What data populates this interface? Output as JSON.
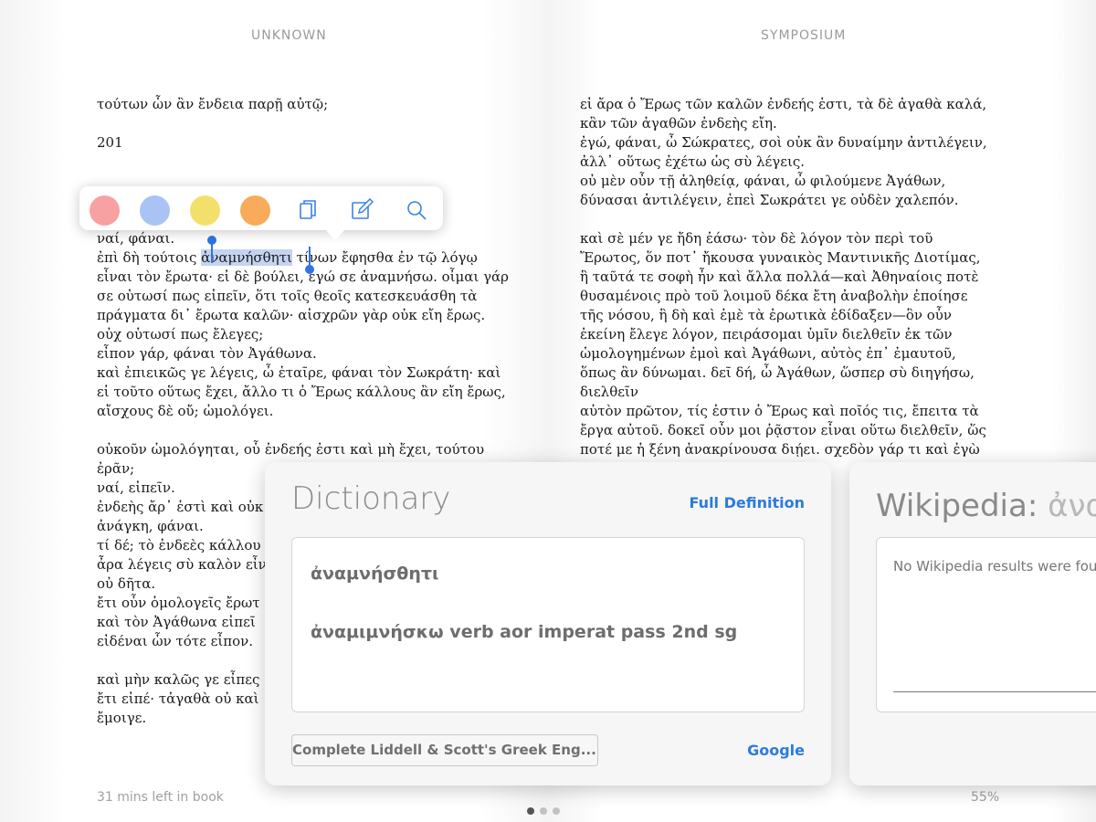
{
  "header": {
    "left_title": "UNKNOWN",
    "right_title": "SYMPOSIUM"
  },
  "left_page": {
    "top_lines": [
      "τούτων ὧν ἂν ἔνδεια παρῇ αὐτῷ;",
      "201"
    ],
    "line_before_selection": "ναί, φάναι.",
    "selection_line": {
      "before": "ἐπὶ δὴ τούτοις ",
      "selected": "ἀναμνήσθητι",
      "after": " τίνων ἔφησθα ἐν τῷ λόγῳ"
    },
    "paragraph1_rest": [
      "εἶναι τὸν ἔρωτα· εἰ δὲ βούλει, ἐγώ σε ἀναμνήσω. οἶμαι γάρ",
      "σε οὑτωσί πως εἰπεῖν, ὅτι τοῖς θεοῖς κατεσκευάσθη τὰ",
      "πράγματα δι᾽ ἔρωτα καλῶν· αἰσχρῶν γὰρ οὐκ εἴη ἔρως.",
      "οὐχ οὑτωσί πως ἔλεγες;",
      "εἶπον γάρ, φάναι τὸν Ἀγάθωνα.",
      "καὶ ἐπιεικῶς γε λέγεις, ὦ ἑταῖρε, φάναι τὸν Σωκράτη· καὶ",
      "εἰ τοῦτο οὕτως ἔχει, ἄλλο τι ὁ Ἔρως κάλλους ἂν εἴη ἔρως,",
      "αἴσχους δὲ οὔ; ὡμολόγει."
    ],
    "paragraph2": [
      "οὐκοῦν ὡμολόγηται, οὗ ἐνδεής ἐστι καὶ μὴ ἔχει, τούτου",
      "ἐρᾶν;",
      "ναί, εἰπεῖν.",
      "ἐνδεὴς ἄρ᾽ ἐστὶ καὶ οὐκ",
      "ἀνάγκη, φάναι.",
      "τί δέ; τὸ ἐνδεὲς κάλλου",
      "ἆρα λέγεις σὺ καλὸν εἶν",
      "οὐ δῆτα.",
      "ἔτι οὖν ὁμολογεῖς ἔρωτ",
      "καὶ τὸν Ἀγάθωνα εἰπεῖ",
      "εἰδέναι ὧν τότε εἶπον."
    ],
    "paragraph3": [
      "καὶ μὴν καλῶς γε εἶπες",
      "ἔτι εἰπέ· τἀγαθὰ οὐ καὶ",
      "ἔμοιγε."
    ],
    "footer": "31 mins left in book"
  },
  "right_page": {
    "paragraph1": [
      "εἰ ἄρα ὁ Ἔρως τῶν καλῶν ἐνδεής ἐστι, τὰ δὲ ἀγαθὰ καλά,",
      "κἂν τῶν ἀγαθῶν ἐνδεὴς εἴη.",
      "ἐγώ, φάναι, ὦ Σώκρατες, σοὶ οὐκ ἂν δυναίμην ἀντιλέγειν,",
      "ἀλλ᾽ οὕτως ἐχέτω ὡς σὺ λέγεις.",
      "οὐ μὲν οὖν τῇ ἀληθείᾳ, φάναι, ὦ φιλούμενε Ἀγάθων,",
      "δύνασαι ἀντιλέγειν, ἐπεὶ Σωκράτει γε οὐδὲν χαλεπόν."
    ],
    "paragraph2": [
      "καὶ σὲ μέν γε ἤδη ἐάσω· τὸν δὲ λόγον τὸν περὶ τοῦ",
      "Ἔρωτος, ὅν ποτ᾽ ἤκουσα γυναικὸς Μαντινικῆς Διοτίμας,",
      "ἣ ταῦτά τε σοφὴ ἦν καὶ ἄλλα πολλά—καὶ Ἀθηναίοις ποτὲ",
      "θυσαμένοις πρὸ τοῦ λοιμοῦ δέκα ἔτη ἀναβολὴν ἐποίησε",
      "τῆς νόσου, ἣ δὴ καὶ ἐμὲ τὰ ἐρωτικὰ ἐδίδαξεν—ὃν οὖν",
      "ἐκείνη ἔλεγε λόγον, πειράσομαι ὑμῖν διελθεῖν ἐκ τῶν",
      "ὡμολογημένων ἐμοὶ καὶ Ἀγάθωνι, αὐτὸς ἐπ᾽ ἐμαυτοῦ,",
      "ὅπως ἂν δύνωμαι. δεῖ δή, ὦ Ἀγάθων, ὥσπερ σὺ διηγήσω,",
      "διελθεῖν",
      "αὐτὸν πρῶτον, τίς ἐστιν ὁ Ἔρως καὶ ποῖός τις, ἔπειτα τὰ",
      "ἔργα αὐτοῦ. δοκεῖ οὖν μοι ῥᾷστον εἶναι οὕτω διελθεῖν, ὥς",
      "ποτέ με ἡ ξένη ἀνακρίνουσα διῄει. σχεδὸν γάρ τι καὶ ἐγὼ"
    ],
    "footer": "55%"
  },
  "highlight_menu": {
    "colors": [
      "#f7a1a3",
      "#a9c3f5",
      "#f3e06b",
      "#f8ab5b"
    ],
    "icons": [
      "copy-icon",
      "note-icon",
      "search-icon"
    ]
  },
  "dictionary": {
    "title": "Dictionary",
    "full_definition": "Full Definition",
    "word": "ἀναμνήσθητι",
    "definition": "ἀναμιμνήσκω verb aor imperat pass 2nd sg",
    "source": "Complete Liddell & Scott's Greek Eng...",
    "google": "Google"
  },
  "wikipedia": {
    "title_prefix": "Wikipedia: ",
    "query": "ἀνα",
    "message": "No Wikipedia results were fou"
  },
  "page_indicator": {
    "pages": 3,
    "active": 1
  }
}
